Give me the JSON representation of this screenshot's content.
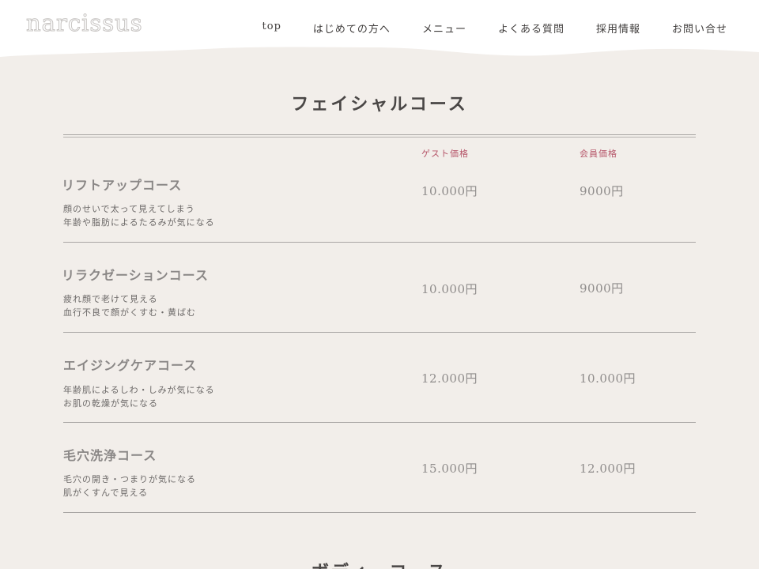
{
  "header": {
    "logo": "narcissus",
    "nav": [
      {
        "label": "top"
      },
      {
        "label": "はじめての方へ"
      },
      {
        "label": "メニュー"
      },
      {
        "label": "よくある質問"
      },
      {
        "label": "採用情報"
      },
      {
        "label": "お問い合せ"
      }
    ]
  },
  "section": {
    "title": "フェイシャルコース",
    "column_guest": "ゲスト価格",
    "column_member": "会員価格",
    "courses": [
      {
        "name": "リフトアップコース",
        "desc1": "顔のせいで太って見えてしまう",
        "desc2": "年齢や脂肪によるたるみが気になる",
        "guest_price": "10.000円",
        "member_price": "9000円"
      },
      {
        "name": "リラクゼーションコース",
        "desc1": "疲れ顔で老けて見える",
        "desc2": "血行不良で顔がくすむ・黄ばむ",
        "guest_price": "10.000円",
        "member_price": "9000円"
      },
      {
        "name": "エイジングケアコース",
        "desc1": "年齢肌によるしわ・しみが気になる",
        "desc2": "お肌の乾燥が気になる",
        "guest_price": "12.000円",
        "member_price": "10.000円"
      },
      {
        "name": "毛穴洗浄コース",
        "desc1": "毛穴の開き・つまりが気になる",
        "desc2": "肌がくすんで見える",
        "guest_price": "15.000円",
        "member_price": "12.000円"
      }
    ]
  },
  "next_section": {
    "title": "ボディーコース"
  },
  "colors": {
    "background": "#f2eeea",
    "header": "#ffffff",
    "accent": "#b6566a",
    "rule": "#a9a6a4"
  }
}
